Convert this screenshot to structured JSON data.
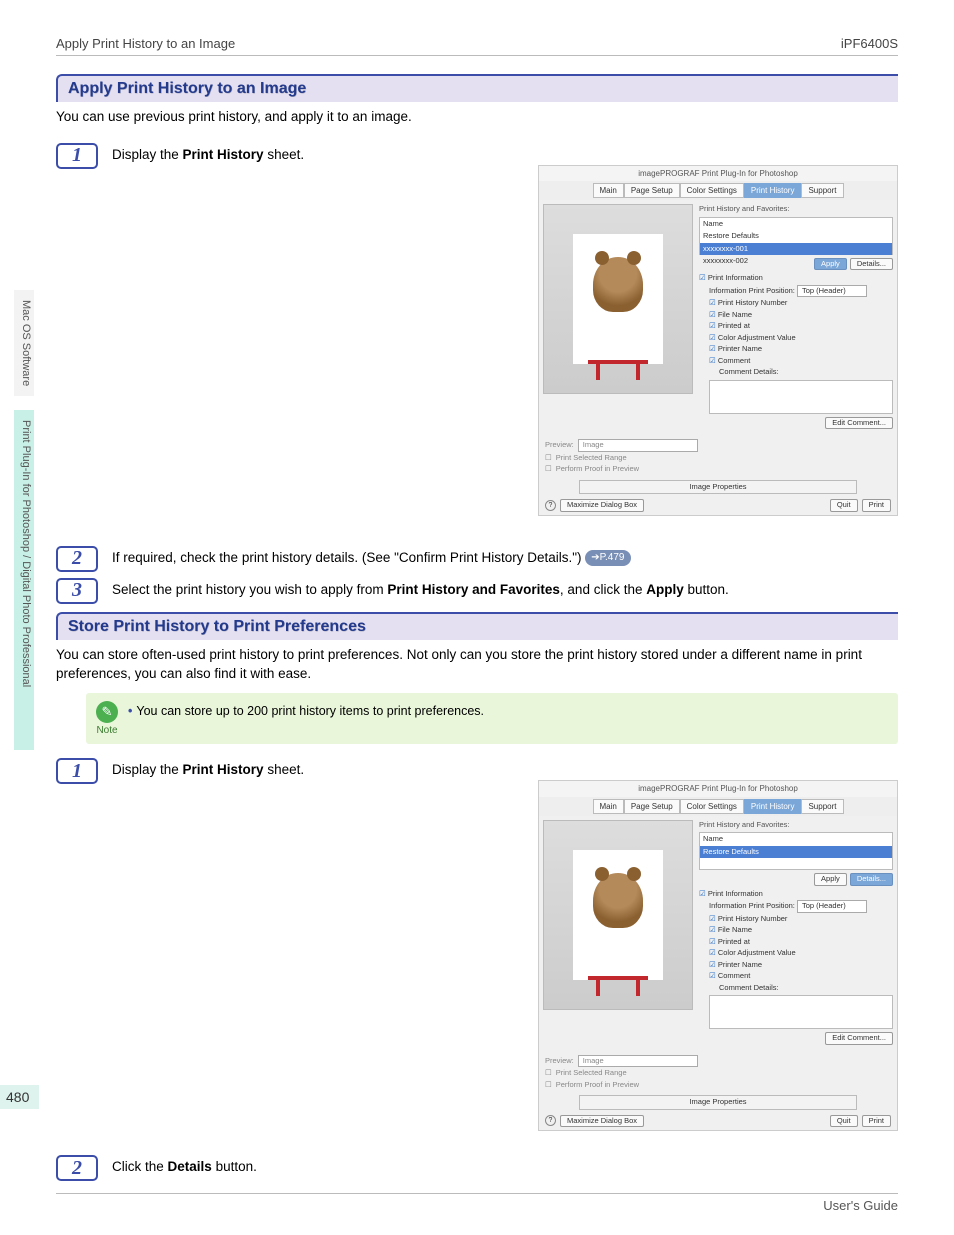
{
  "header": {
    "left": "Apply Print History to an Image",
    "right": "iPF6400S"
  },
  "sideTabs": {
    "a": "Mac OS Software",
    "b": "Print Plug-In for Photoshop / Digital Photo Professional"
  },
  "pageNumber": "480",
  "footer": "User's Guide",
  "section1": {
    "title": "Apply Print History to an Image",
    "intro": "You can use previous print history, and apply it to an image.",
    "step1_a": "Display the ",
    "step1_b": "Print History",
    "step1_c": " sheet.",
    "step2_a": "If required, check the print history details.  (See \"Confirm Print History Details.\") ",
    "step2_ref": "➔P.479",
    "step3_a": "Select the print history you wish to apply from ",
    "step3_b": "Print History and Favorites",
    "step3_c": ", and click the ",
    "step3_d": "Apply",
    "step3_e": " button."
  },
  "section2": {
    "title": "Store Print History to Print Preferences",
    "intro": "You can store often-used print history to print preferences. Not only can you store the print history stored under a different name in print preferences, you can also find it with ease.",
    "noteLabel": "Note",
    "noteText": "You can store up to 200 print history items to print preferences.",
    "step1_a": "Display the ",
    "step1_b": "Print History",
    "step1_c": " sheet.",
    "step2_a": "Click the ",
    "step2_b": "Details",
    "step2_c": " button."
  },
  "shot": {
    "title": "imagePROGRAF Print Plug-In for Photoshop",
    "tabs": {
      "main": "Main",
      "page": "Page Setup",
      "color": "Color Settings",
      "hist": "Print History",
      "support": "Support"
    },
    "favLabel": "Print History and Favorites:",
    "listName": "Name",
    "restore": "Restore Defaults",
    "item1": "xxxxxxxx-001",
    "item2": "xxxxxxxx-002",
    "apply": "Apply",
    "details": "Details...",
    "printInfo": "Print Information",
    "infoPos": "Information Print Position:",
    "topHeader": "Top (Header)",
    "chkHist": "Print History Number",
    "chkFile": "File Name",
    "chkPrinted": "Printed at",
    "chkColor": "Color Adjustment Value",
    "chkPrinter": "Printer Name",
    "chkComment": "Comment",
    "commentDetails": "Comment Details:",
    "editComment": "Edit Comment...",
    "previewLabel": "Preview:",
    "previewVal": "Image",
    "printSel": "Print Selected Range",
    "perform": "Perform Proof in Preview",
    "imgProps": "Image Properties",
    "maxDialog": "Maximize Dialog Box",
    "quit": "Quit",
    "print": "Print"
  }
}
